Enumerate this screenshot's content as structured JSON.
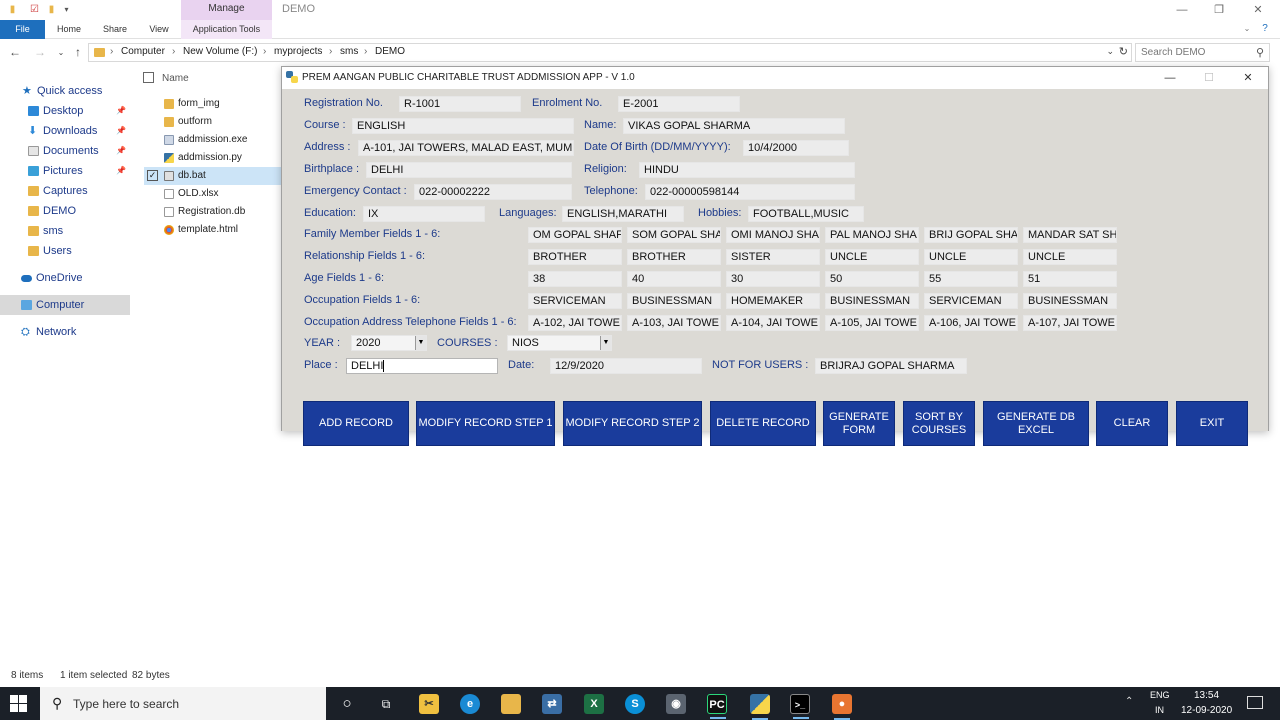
{
  "explorer": {
    "manage_tab": "Manage",
    "window_title": "DEMO",
    "ribbon_tabs": [
      "File",
      "Home",
      "Share",
      "View",
      "Application Tools"
    ],
    "breadcrumb": [
      "Computer",
      "New Volume (F:)",
      "myprojects",
      "sms",
      "DEMO"
    ],
    "search_placeholder": "Search DEMO",
    "nav": {
      "quick_access": "Quick access",
      "items": [
        "Desktop",
        "Downloads",
        "Documents",
        "Pictures",
        "Captures",
        "DEMO",
        "sms",
        "Users"
      ],
      "onedrive": "OneDrive",
      "computer": "Computer",
      "network": "Network"
    },
    "column_name": "Name",
    "files": [
      "form_img",
      "outform",
      "addmission.exe",
      "addmission.py",
      "db.bat",
      "OLD.xlsx",
      "Registration.db",
      "template.html"
    ],
    "status": {
      "items": "8 items",
      "selected": "1 item selected",
      "size": "82 bytes"
    }
  },
  "app": {
    "title": "PREM AANGAN PUBLIC CHARITABLE TRUST ADDMISSION APP - V 1.0",
    "labels": {
      "registration": "Registration No.",
      "enrolment": "Enrolment No.",
      "course": "Course :",
      "name": "Name:",
      "address": "Address :",
      "dob": "Date Of Birth (DD/MM/YYYY):",
      "birthplace": "Birthplace :",
      "religion": "Religion:",
      "emergency": "Emergency Contact :",
      "telephone": "Telephone:",
      "education": "Education:",
      "languages": "Languages:",
      "hobbies": "Hobbies:",
      "family": "Family Member Fields 1 - 6:",
      "relationship": "Relationship Fields 1 - 6:",
      "age": "Age Fields 1 - 6:",
      "occupation": "Occupation Fields 1 - 6:",
      "occ_address": "Occupation Address Telephone Fields 1 - 6:",
      "year": "YEAR :",
      "courses": "COURSES :",
      "place": "Place :",
      "date": "Date:",
      "not_for_users": "NOT FOR USERS :"
    },
    "values": {
      "registration": "R-1001",
      "enrolment": "E-2001",
      "course": "ENGLISH",
      "name": "VIKAS GOPAL SHARMA",
      "address": "A-101, JAI TOWERS, MALAD EAST, MUMI",
      "dob": "10/4/2000",
      "birthplace": "DELHI",
      "religion": "HINDU",
      "emergency": "022-00002222",
      "telephone": "022-00000598144",
      "education": "IX",
      "languages": "ENGLISH,MARATHI",
      "hobbies": "FOOTBALL,MUSIC",
      "family": [
        "OM GOPAL SHAF",
        "SOM GOPAL SHA",
        "OMI MANOJ SHAI",
        "PAL MANOJ SHA",
        "BRIJ GOPAL SHA",
        "MANDAR SAT SH"
      ],
      "relationship": [
        "BROTHER",
        "BROTHER",
        "SISTER",
        "UNCLE",
        "UNCLE",
        "UNCLE"
      ],
      "age": [
        "38",
        "40",
        "30",
        "50",
        "55",
        "51"
      ],
      "occupation": [
        "SERVICEMAN",
        "BUSINESSMAN",
        "HOMEMAKER",
        "BUSINESSMAN",
        "SERVICEMAN",
        "BUSINESSMAN"
      ],
      "occ_address": [
        "A-102, JAI TOWEI",
        "A-103, JAI TOWEI",
        "A-104, JAI TOWEI",
        "A-105, JAI TOWEI",
        "A-106, JAI TOWEI",
        "A-107, JAI TOWEI"
      ],
      "year": "2020",
      "courses": "NIOS",
      "place": "DELHI",
      "date": "12/9/2020",
      "not_for_users": "BRIJRAJ GOPAL SHARMA"
    },
    "buttons": {
      "add": "ADD RECORD",
      "modify1": "MODIFY RECORD STEP 1",
      "modify2": "MODIFY RECORD STEP 2",
      "delete": "DELETE RECORD",
      "generate_form": "GENERATE FORM",
      "sort": "SORT BY COURSES",
      "generate_db": "GENERATE DB EXCEL",
      "clear": "CLEAR",
      "exit": "EXIT"
    },
    "colors": {
      "label": "#1d3a8a",
      "button": "#1a3c9c",
      "form_bg": "#dcdad5"
    }
  },
  "taskbar": {
    "search_placeholder": "Type here to search",
    "lang_top": "ENG",
    "lang_bottom": "IN",
    "time": "13:54",
    "date": "12-09-2020"
  }
}
